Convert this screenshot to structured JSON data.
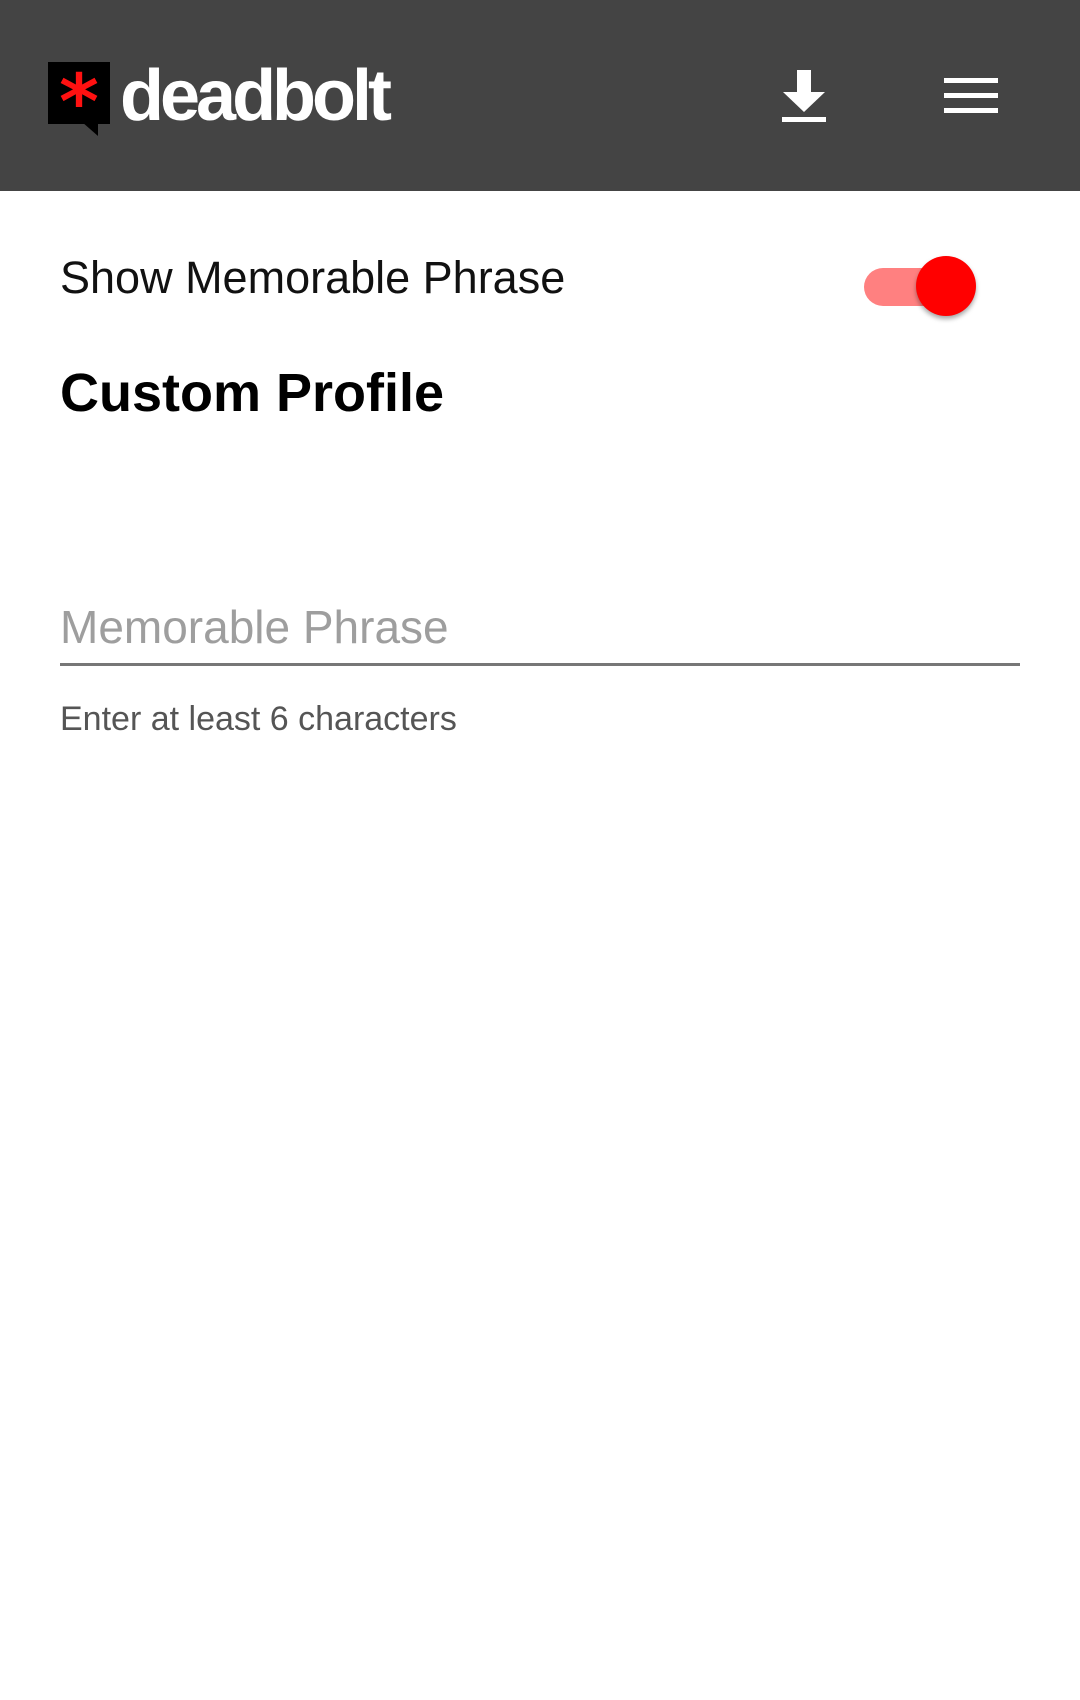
{
  "header": {
    "brand": "deadbolt",
    "logo_mark": "*",
    "icons": {
      "download": "download-icon",
      "menu": "menu-icon"
    },
    "background": "#444444"
  },
  "settings": {
    "show_phrase_label": "Show Memorable Phrase",
    "show_phrase_on": true,
    "accent": "#ff0000"
  },
  "profile": {
    "title": "Custom Profile",
    "phrase_value": "",
    "phrase_placeholder": "Memorable Phrase",
    "helper": "Enter at least 6 characters"
  }
}
